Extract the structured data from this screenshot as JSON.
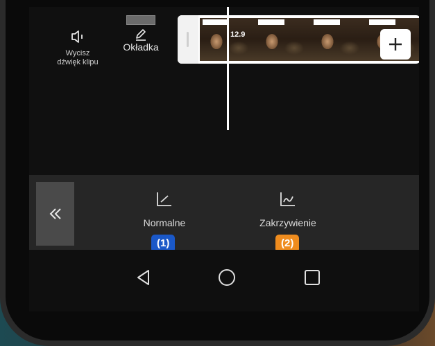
{
  "editor": {
    "mute_label_line1": "Wycisz",
    "mute_label_line2": "dźwięk klipu",
    "cover_label": "Okładka",
    "clip_time": "12.9",
    "add_icon": "plus-icon"
  },
  "toolbar": {
    "back_icon": "double-chevron-left-icon",
    "tools": [
      {
        "label": "Normalne",
        "icon": "speed-normal-icon",
        "badge": "(1)"
      },
      {
        "label": "Zakrzywienie",
        "icon": "speed-curve-icon",
        "badge": "(2)"
      }
    ]
  },
  "navbar": {
    "back": "back-triangle-icon",
    "home": "home-circle-icon",
    "recents": "recents-square-icon"
  },
  "colors": {
    "badge_blue": "#1a58c8",
    "badge_orange": "#ef8c1e"
  }
}
